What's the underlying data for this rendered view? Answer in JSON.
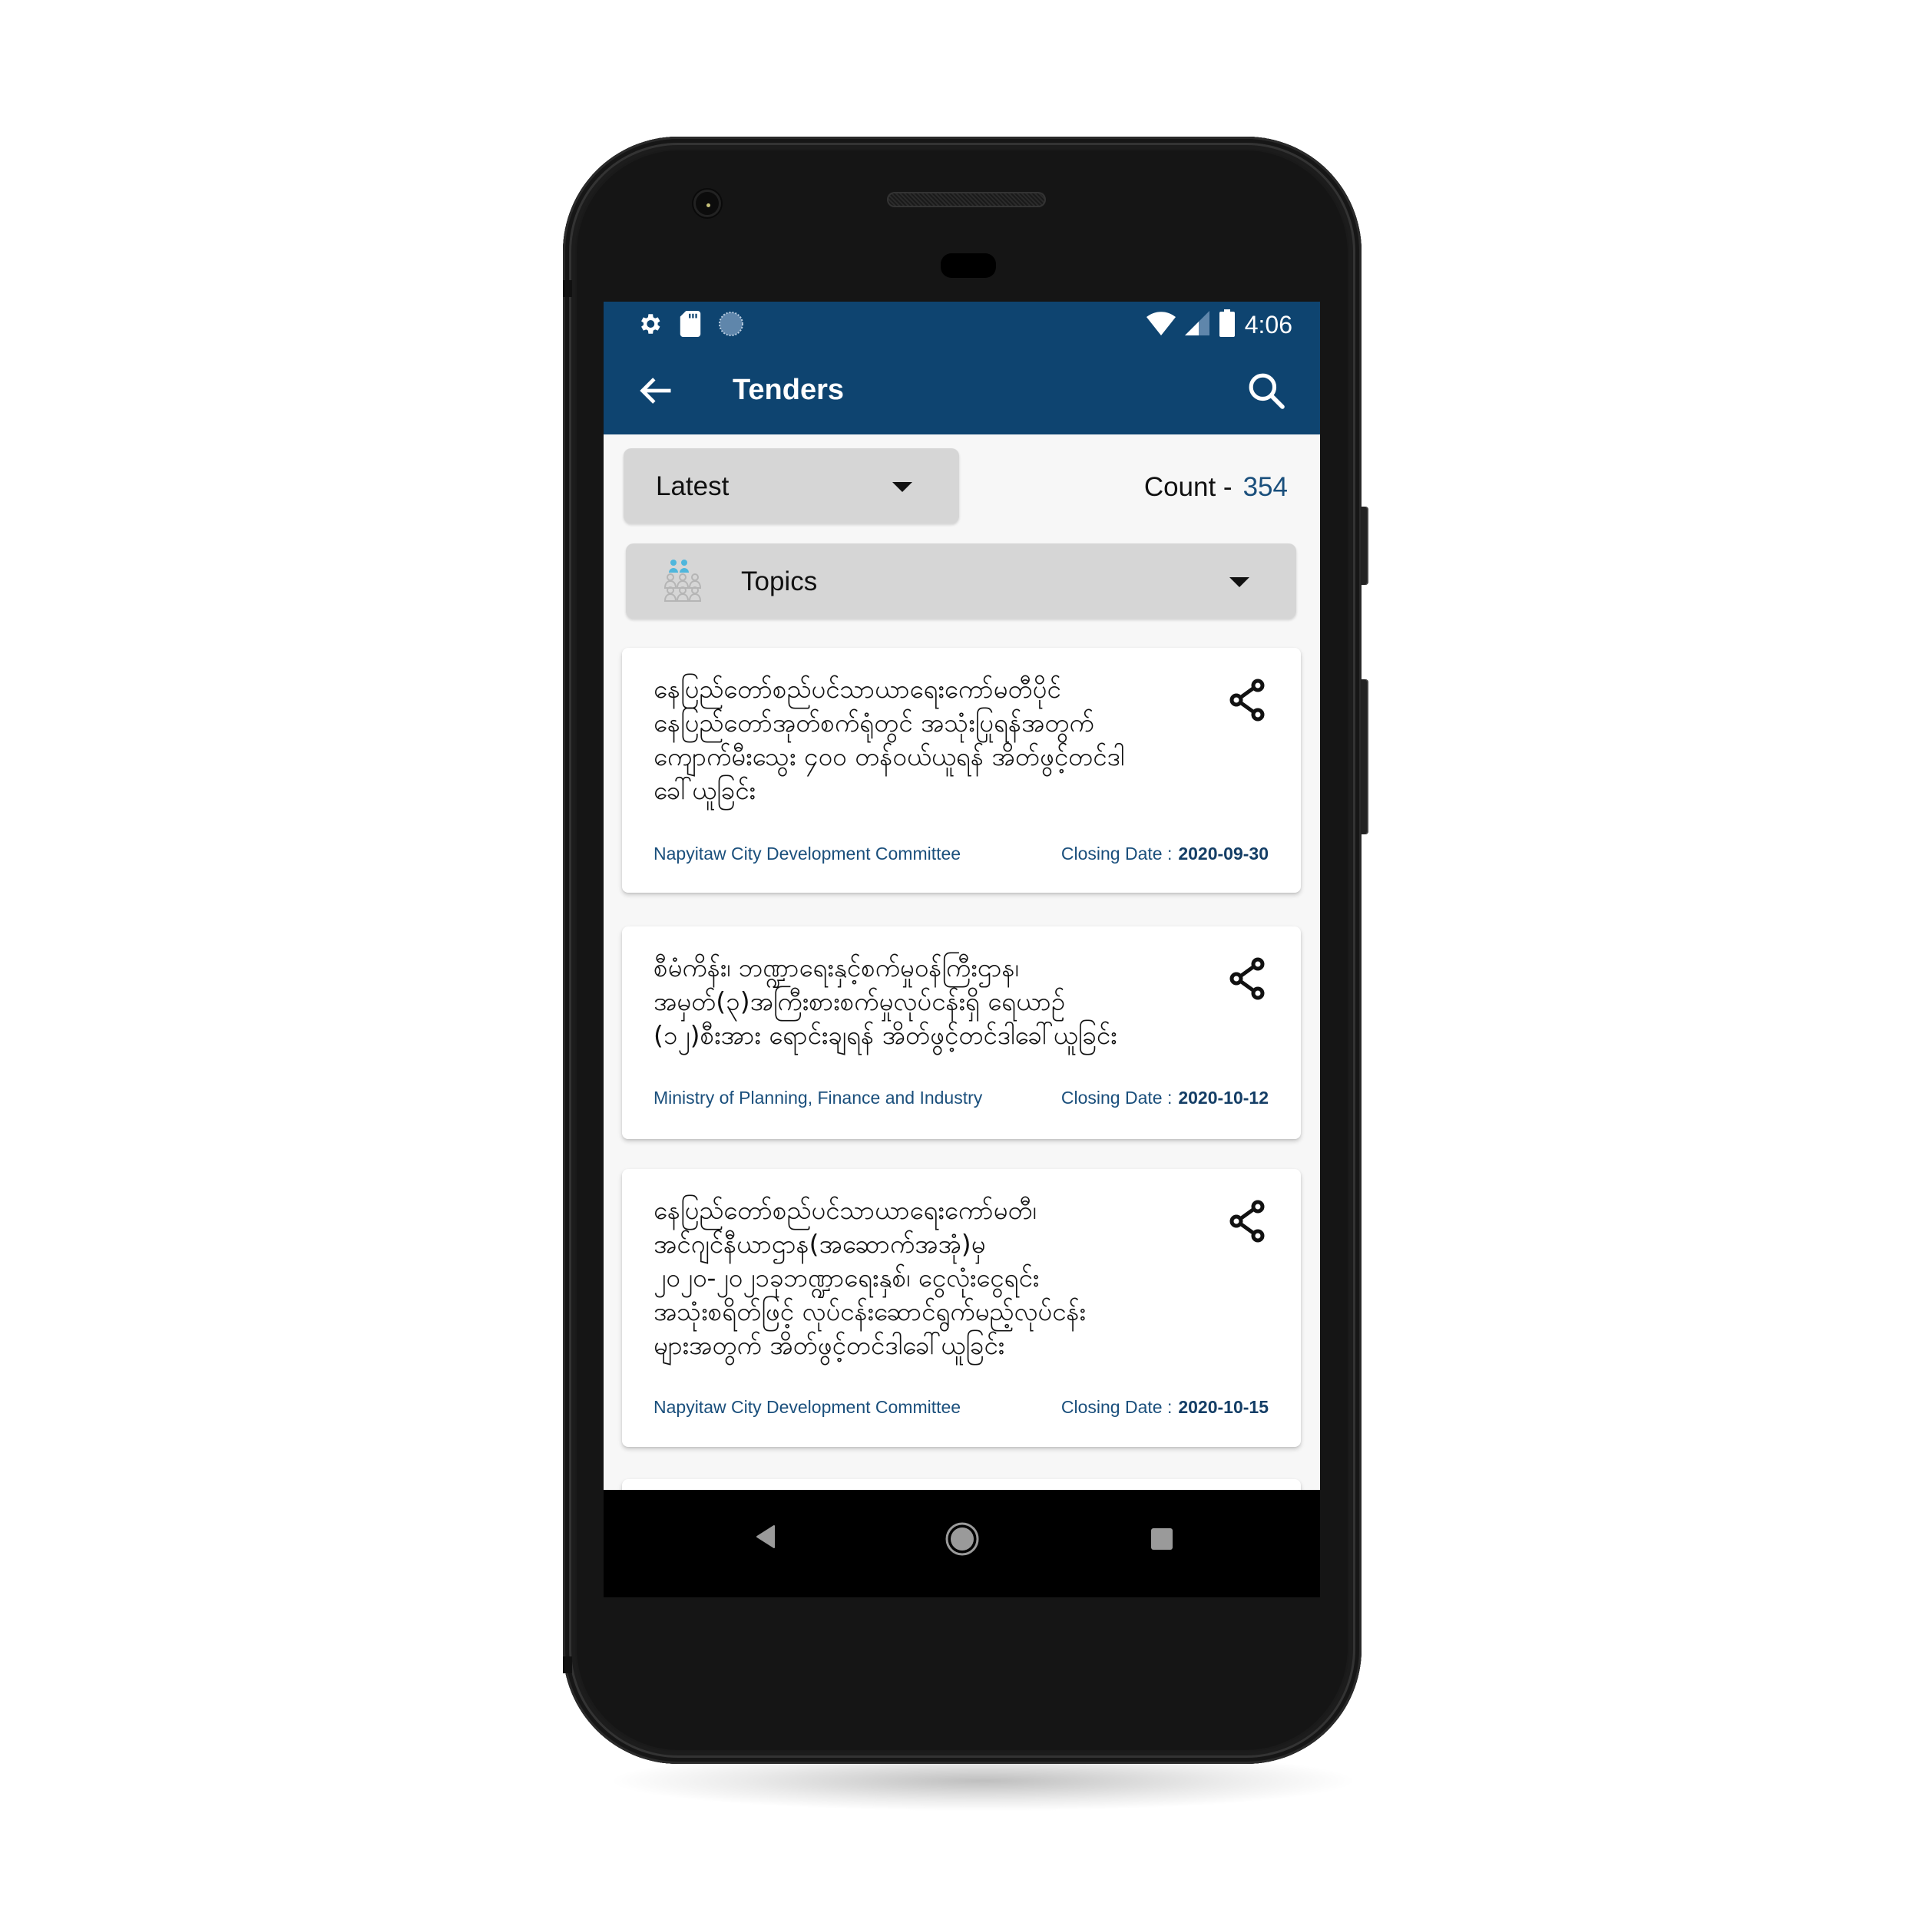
{
  "status_bar": {
    "left_icons": [
      "settings-gear-icon",
      "sd-card-icon",
      "sync-circle-icon"
    ],
    "right_icons": [
      "wifi-icon",
      "cell-signal-icon",
      "battery-icon"
    ],
    "time": "4:06"
  },
  "app_bar": {
    "title": "Tenders",
    "back_icon": "arrow-left-icon",
    "search_icon": "search-icon",
    "color": "#0e4470"
  },
  "filters": {
    "sort": {
      "selected": "Latest"
    },
    "count_label": "Count -",
    "count_value": "354",
    "topics": {
      "selected": "Topics",
      "icon": "people-group-icon"
    }
  },
  "tenders": [
    {
      "title": "နေပြည်တော်စည်ပင်သာယာရေးကော်မတီပိုင်\nနေပြည်တော်အုတ်စက်ရုံတွင် အသုံးပြုရန်အတွက်\nကျောက်မီးသွေး ၄၀၀ တန်ဝယ်ယူရန် အိတ်ဖွင့်တင်ဒါ\nခေါ်ယူခြင်း",
      "organization": "Napyitaw City Development Committee",
      "closing_label": "Closing Date :",
      "closing_date": "2020-09-30"
    },
    {
      "title": "စီမံကိန်း၊ ဘဏ္ဍာရေးနှင့်စက်မှုဝန်ကြီးဌာန၊\nအမှတ်(၃)အကြီးစားစက်မှုလုပ်ငန်းရှိ ရေယာဉ်\n(၁၂)စီးအား ရောင်းချရန် အိတ်ဖွင့်တင်ဒါခေါ်ယူခြင်း",
      "organization": "Ministry of Planning, Finance and Industry",
      "closing_label": "Closing Date :",
      "closing_date": "2020-10-12"
    },
    {
      "title": "နေပြည်တော်စည်ပင်သာယာရေးကော်မတီ၊\nအင်ဂျင်နီယာဌာန(အဆောက်အအုံ)မှ\n၂၀၂၀-၂၀၂၁ခုဘဏ္ဍာရေးနှစ်၊ ငွေလုံးငွေရင်း\nအသုံးစရိတ်ဖြင့် လုပ်ငန်းဆောင်ရွက်မည့်လုပ်ငန်း\nများအတွက် အိတ်ဖွင့်တင်ဒါခေါ်ယူခြင်း",
      "organization": "Napyitaw City Development Committee",
      "closing_label": "Closing Date :",
      "closing_date": "2020-10-15"
    }
  ],
  "nav_bar": {
    "buttons": [
      "back-triangle-icon",
      "home-circle-icon",
      "recents-square-icon"
    ]
  }
}
